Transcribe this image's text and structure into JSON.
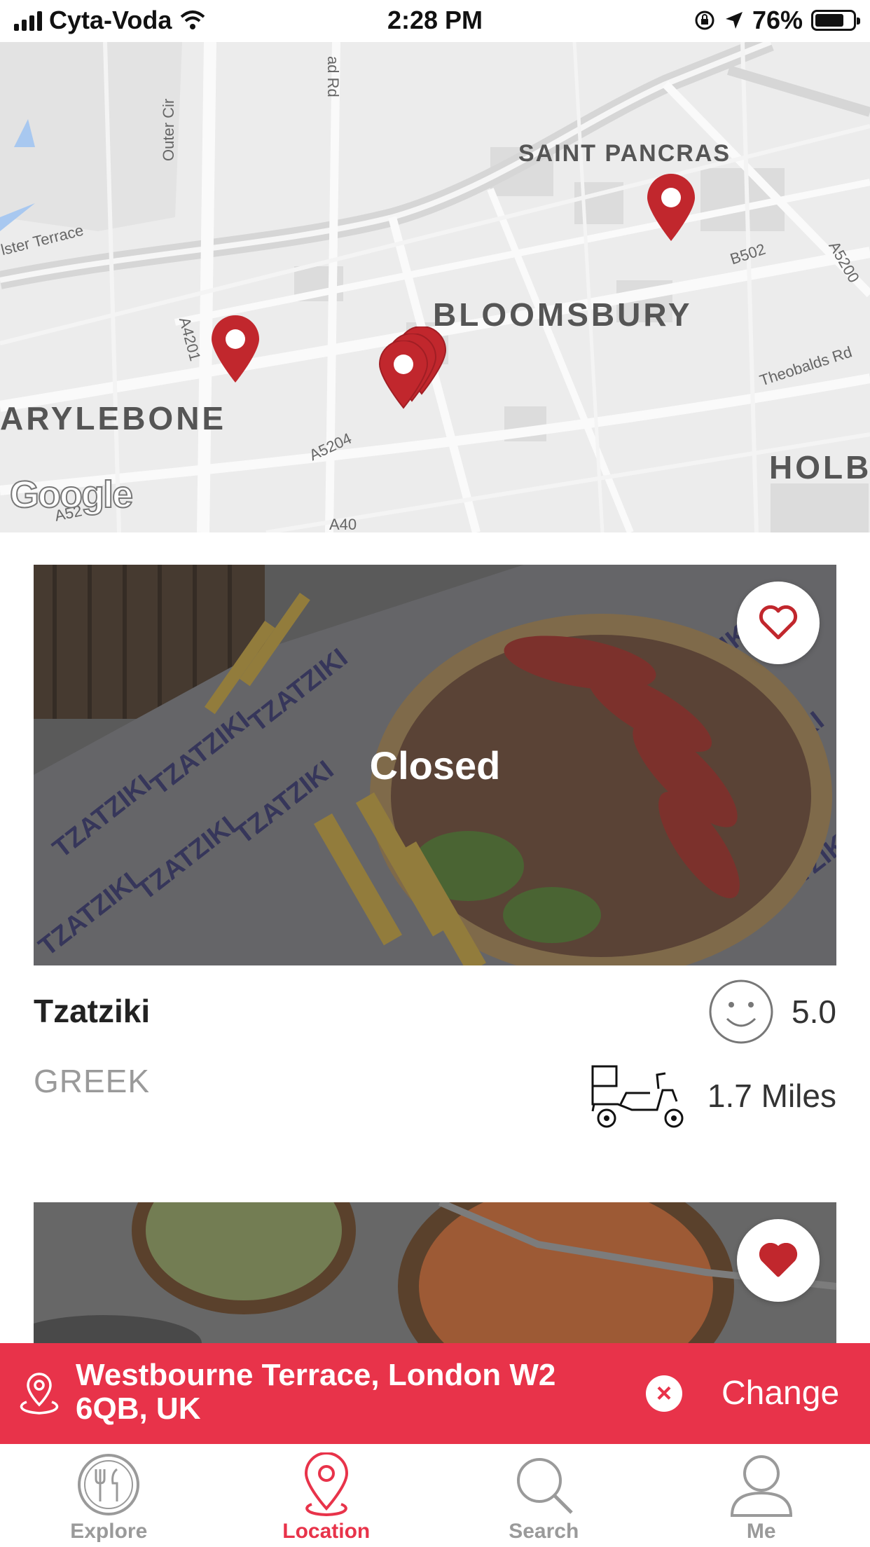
{
  "status_bar": {
    "carrier": "Cyta-Voda",
    "time": "2:28 PM",
    "battery": "76%"
  },
  "map": {
    "areas": [
      "SAINT PANCRAS",
      "BLOOMSBURY",
      "ARYLEBONE",
      "HOLB"
    ],
    "roads": [
      "Outer Cir",
      "ad Rd",
      "lster Terrace",
      "A4201",
      "A5204",
      "B502",
      "A5200",
      "Theobalds Rd",
      "A52",
      "A40"
    ],
    "logo": "Google",
    "pin_color": "#c1272d"
  },
  "restaurants": [
    {
      "name": "Tzatziki",
      "cuisine": "GREEK",
      "status": "Closed",
      "rating": "5.0",
      "distance": "1.7 Miles",
      "favorite": false
    },
    {
      "favorite": true
    }
  ],
  "location_bar": {
    "address": "Westbourne Terrace, London W2 6QB, UK",
    "change_label": "Change",
    "accent": "#e8334a"
  },
  "tabs": [
    {
      "label": "Explore",
      "icon": "cutlery-icon",
      "active": false
    },
    {
      "label": "Location",
      "icon": "location-pin-icon",
      "active": true
    },
    {
      "label": "Search",
      "icon": "search-icon",
      "active": false
    },
    {
      "label": "Me",
      "icon": "user-icon",
      "active": false
    }
  ]
}
